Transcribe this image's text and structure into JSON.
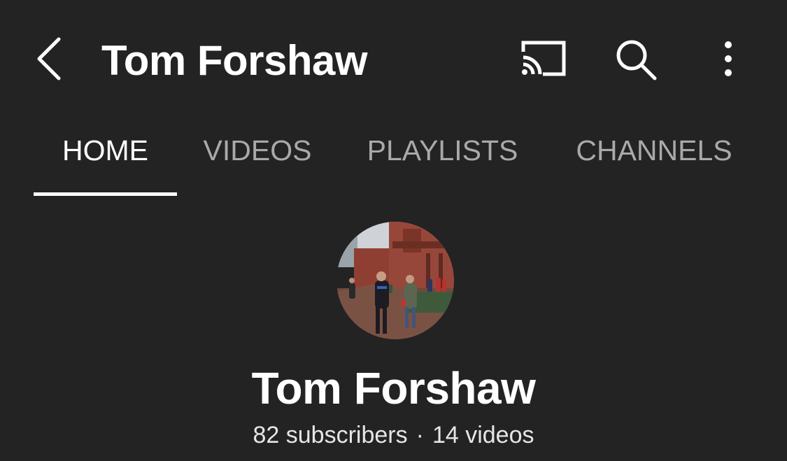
{
  "header": {
    "title": "Tom Forshaw",
    "icons": [
      "back-icon",
      "cast-icon",
      "search-icon",
      "more-vert-icon"
    ]
  },
  "tabs": [
    {
      "label": "HOME",
      "active": true
    },
    {
      "label": "VIDEOS",
      "active": false
    },
    {
      "label": "PLAYLISTS",
      "active": false
    },
    {
      "label": "CHANNELS",
      "active": false
    }
  ],
  "channel": {
    "name": "Tom Forshaw",
    "subscribers": "82 subscribers",
    "separator": "·",
    "videos": "14 videos"
  },
  "colors": {
    "background": "#232323",
    "text_primary": "#ffffff",
    "text_inactive_tab": "#a9a9a9",
    "brick": "#8a3c2e"
  }
}
